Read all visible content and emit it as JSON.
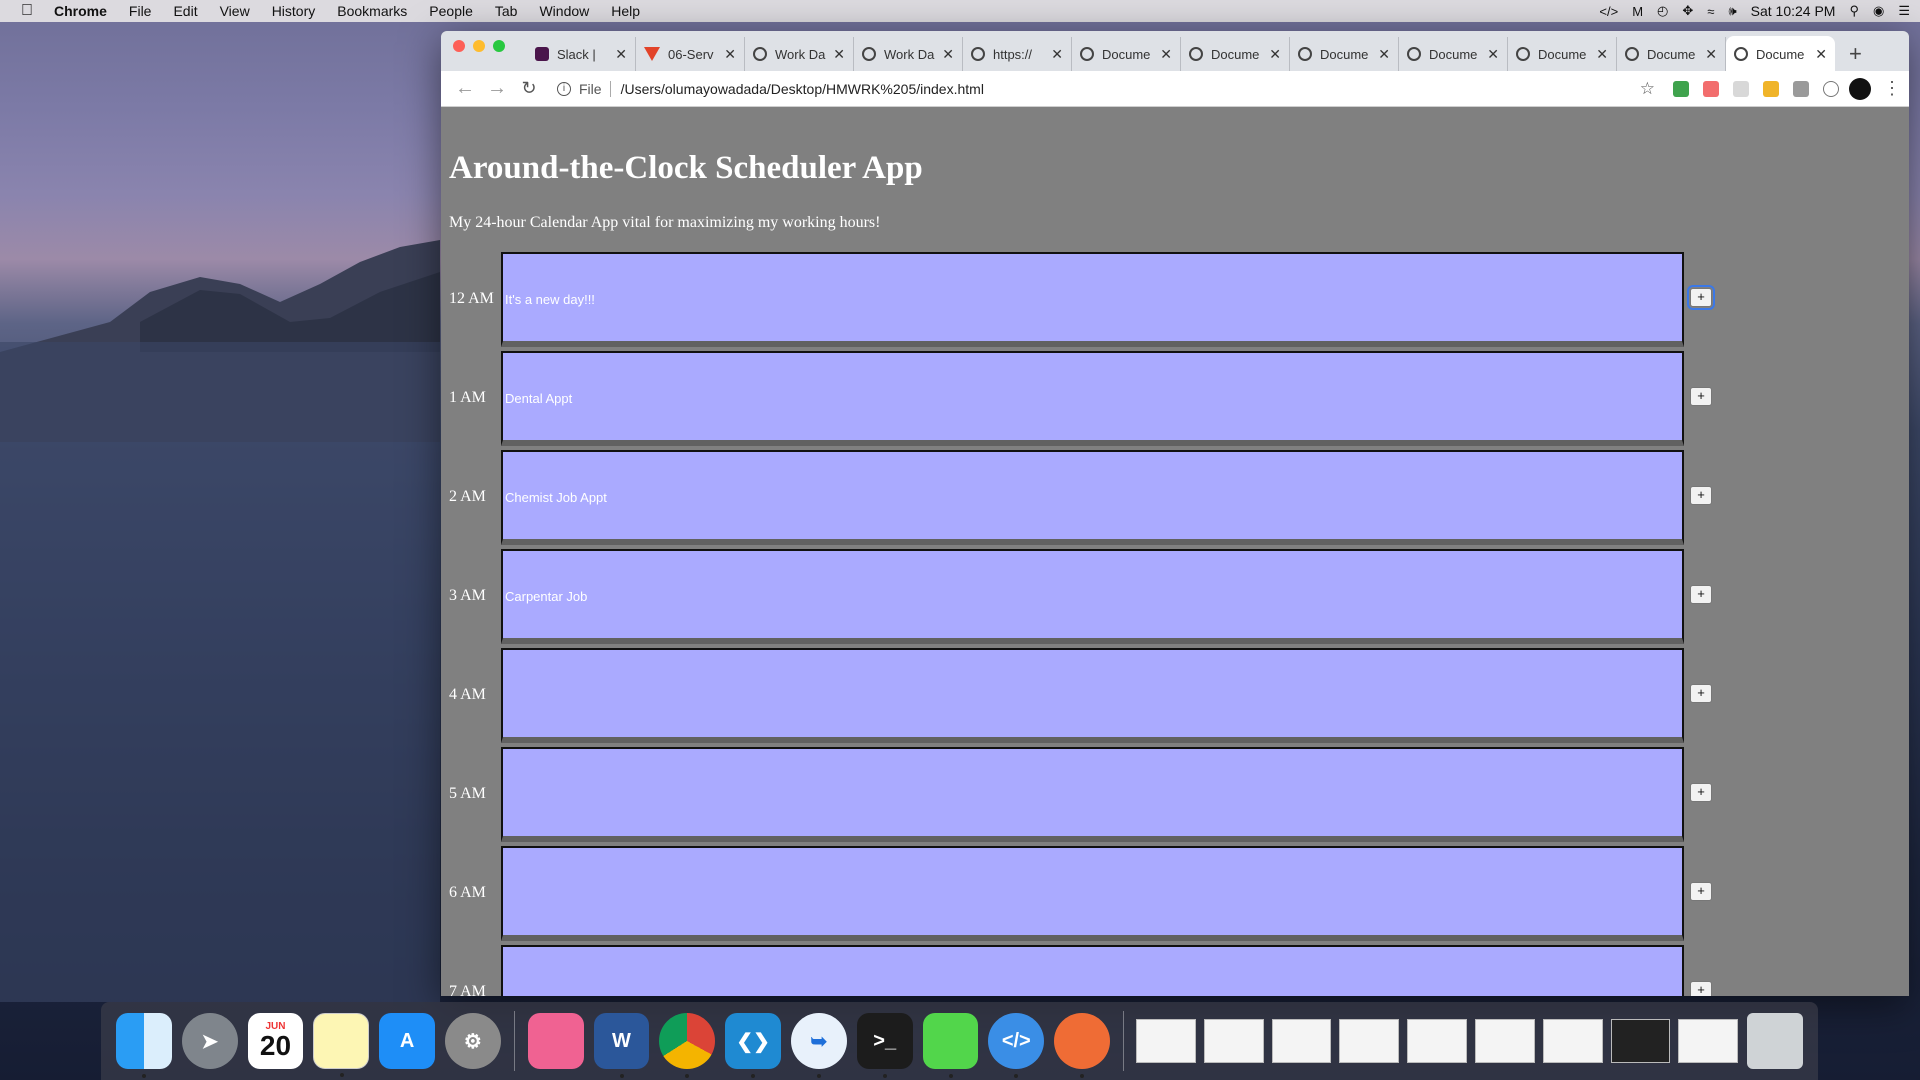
{
  "menubar": {
    "app_name": "Chrome",
    "items": [
      "File",
      "Edit",
      "View",
      "History",
      "Bookmarks",
      "People",
      "Tab",
      "Window",
      "Help"
    ],
    "clock": "Sat 10:24 PM"
  },
  "browser": {
    "tabs": [
      {
        "title": "Slack | ",
        "icon": "slack-icon"
      },
      {
        "title": "06-Serv",
        "icon": "gitlab-icon"
      },
      {
        "title": "Work Da",
        "icon": "globe-icon"
      },
      {
        "title": "Work Da",
        "icon": "globe-icon"
      },
      {
        "title": "https://",
        "icon": "globe-icon"
      },
      {
        "title": "Docume",
        "icon": "globe-icon"
      },
      {
        "title": "Docume",
        "icon": "globe-icon"
      },
      {
        "title": "Docume",
        "icon": "globe-icon"
      },
      {
        "title": "Docume",
        "icon": "globe-icon"
      },
      {
        "title": "Docume",
        "icon": "globe-icon"
      },
      {
        "title": "Docume",
        "icon": "globe-icon"
      },
      {
        "title": "Docume",
        "icon": "globe-icon"
      }
    ],
    "active_tab_index": 11,
    "new_tab_label": "+",
    "url_scheme": "File",
    "url": "/Users/olumayowadada/Desktop/HMWRK%205/index.html"
  },
  "page": {
    "title": "Around-the-Clock Scheduler App",
    "subtitle": "My 24-hour Calendar App vital for maximizing my working hours!",
    "save_label": "+",
    "rows": [
      {
        "hour": "12 AM",
        "text": "It's a new day!!!"
      },
      {
        "hour": "1 AM",
        "text": "Dental Appt"
      },
      {
        "hour": "2 AM",
        "text": "Chemist Job Appt"
      },
      {
        "hour": "3 AM",
        "text": "Carpentar Job"
      },
      {
        "hour": "4 AM",
        "text": ""
      },
      {
        "hour": "5 AM",
        "text": ""
      },
      {
        "hour": "6 AM",
        "text": ""
      },
      {
        "hour": "7 AM",
        "text": ""
      }
    ]
  },
  "dock": {
    "calendar_month": "JUN",
    "calendar_day": "20"
  },
  "colors": {
    "page_bg": "#808080",
    "row_bg": "#aaaaff",
    "focus": "#3b78e7"
  }
}
